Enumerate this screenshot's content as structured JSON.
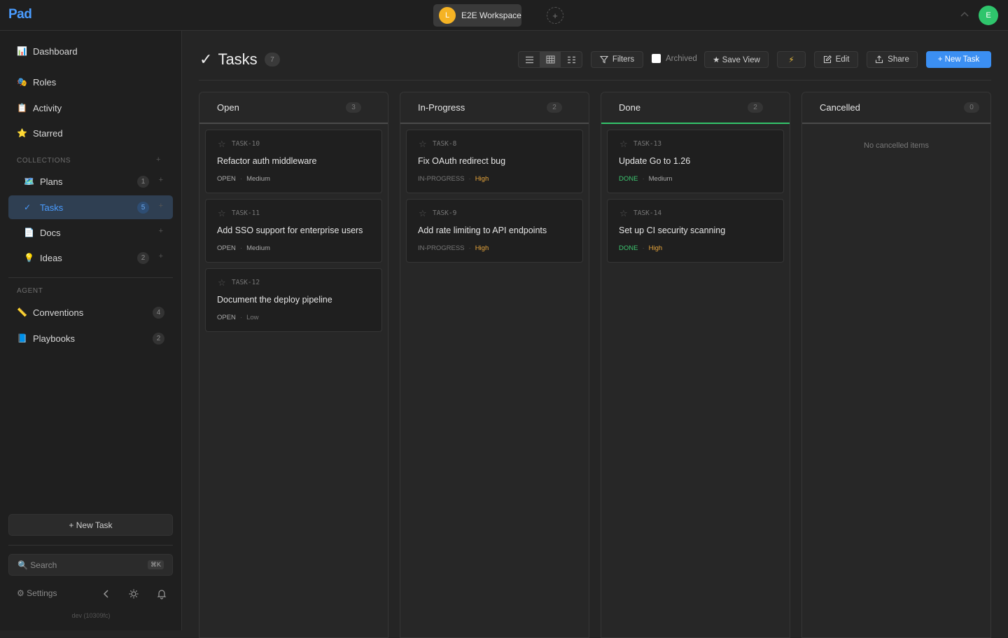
{
  "app": {
    "logo": "Pad"
  },
  "topbar": {
    "workspace_initial": "L",
    "workspace_name": "E2E Workspace",
    "add_label": "+",
    "user_initial": "E"
  },
  "sidebar": {
    "items_top": [
      {
        "icon": "📊",
        "label": "Dashboard"
      },
      {
        "icon": "🎭",
        "label": "Roles"
      },
      {
        "icon": "📋",
        "label": "Activity"
      },
      {
        "icon": "⭐",
        "label": "Starred"
      }
    ],
    "collections_label": "COLLECTIONS",
    "collections": [
      {
        "icon": "🗺️",
        "label": "Plans",
        "count": "1"
      },
      {
        "icon": "✓",
        "label": "Tasks",
        "count": "5",
        "active": true
      },
      {
        "icon": "📄",
        "label": "Docs",
        "count": ""
      },
      {
        "icon": "💡",
        "label": "Ideas",
        "count": "2"
      }
    ],
    "agent_label": "AGENT",
    "agent": [
      {
        "icon": "📏",
        "label": "Conventions",
        "count": "4"
      },
      {
        "icon": "📘",
        "label": "Playbooks",
        "count": "2"
      }
    ],
    "new_task": "+ New Task",
    "search_placeholder": "🔍 Search",
    "search_kbd": "⌘K",
    "settings": "⚙ Settings",
    "version": "dev (10309fc)"
  },
  "header": {
    "check": "✓",
    "title": "Tasks",
    "count": "7",
    "filters": "Filters",
    "archived": "Archived",
    "save_view": "★ Save View",
    "bolt": "⚡",
    "edit": "Edit",
    "share": "Share",
    "new_task": "+ New Task"
  },
  "board": {
    "empty_cancelled": "No cancelled items",
    "columns": [
      {
        "title": "Open",
        "count": "3",
        "cards": [
          {
            "key": "TASK-10",
            "title": "Refactor auth middleware",
            "status": "OPEN",
            "priority": "Medium"
          },
          {
            "key": "TASK-11",
            "title": "Add SSO support for enterprise users",
            "status": "OPEN",
            "priority": "Medium"
          },
          {
            "key": "TASK-12",
            "title": "Document the deploy pipeline",
            "status": "OPEN",
            "priority": "Low"
          }
        ]
      },
      {
        "title": "In-Progress",
        "count": "2",
        "cards": [
          {
            "key": "TASK-8",
            "title": "Fix OAuth redirect bug",
            "status": "IN-PROGRESS",
            "priority": "High"
          },
          {
            "key": "TASK-9",
            "title": "Add rate limiting to API endpoints",
            "status": "IN-PROGRESS",
            "priority": "High"
          }
        ]
      },
      {
        "title": "Done",
        "count": "2",
        "cards": [
          {
            "key": "TASK-13",
            "title": "Update Go to 1.26",
            "status": "DONE",
            "priority": "Medium"
          },
          {
            "key": "TASK-14",
            "title": "Set up CI security scanning",
            "status": "DONE",
            "priority": "High"
          }
        ]
      },
      {
        "title": "Cancelled",
        "count": "0",
        "cards": []
      }
    ]
  },
  "colors": {
    "accent": "#3b8ff3",
    "done": "#34c46b",
    "high": "#e7a53b"
  }
}
